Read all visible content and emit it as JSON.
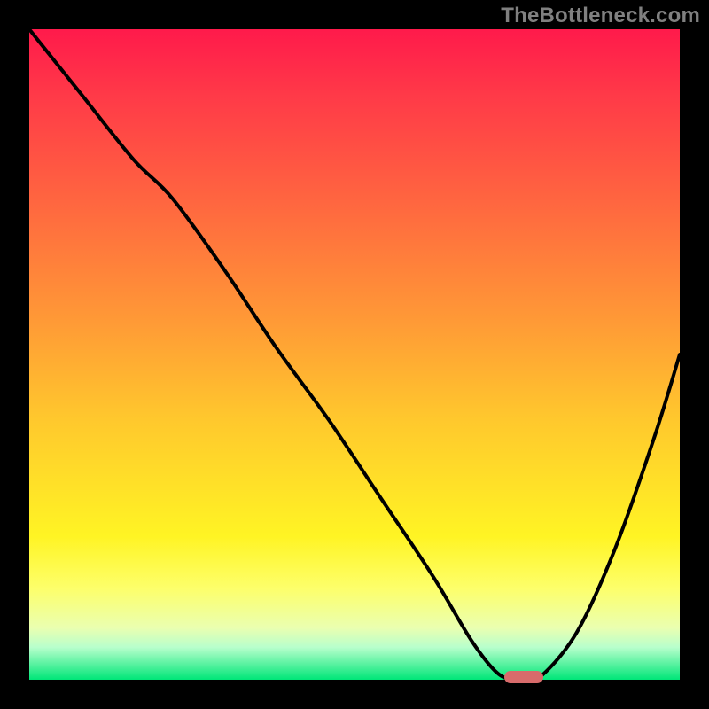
{
  "watermark": "TheBottleneck.com",
  "chart_data": {
    "type": "line",
    "title": "",
    "xlabel": "",
    "ylabel": "",
    "xlim": [
      0,
      100
    ],
    "ylim": [
      0,
      100
    ],
    "gradient_stops": [
      {
        "pct": 0,
        "color": "#ff1a4b"
      },
      {
        "pct": 10,
        "color": "#ff3948"
      },
      {
        "pct": 28,
        "color": "#ff6a3f"
      },
      {
        "pct": 45,
        "color": "#ff9a36"
      },
      {
        "pct": 60,
        "color": "#ffc82d"
      },
      {
        "pct": 78,
        "color": "#fff424"
      },
      {
        "pct": 86,
        "color": "#fdff6b"
      },
      {
        "pct": 92,
        "color": "#eaffb0"
      },
      {
        "pct": 95,
        "color": "#b8ffcc"
      },
      {
        "pct": 100,
        "color": "#00e678"
      }
    ],
    "series": [
      {
        "name": "bottleneck-curve",
        "x": [
          0,
          8,
          16,
          22,
          30,
          38,
          46,
          54,
          62,
          68,
          72,
          75,
          78,
          84,
          90,
          96,
          100
        ],
        "values": [
          100,
          90,
          80,
          74,
          63,
          51,
          40,
          28,
          16,
          6,
          1,
          0,
          0,
          7,
          20,
          37,
          50
        ]
      }
    ],
    "marker": {
      "x": 76,
      "y": 0,
      "shape": "pill",
      "color": "#d86b6b"
    }
  }
}
